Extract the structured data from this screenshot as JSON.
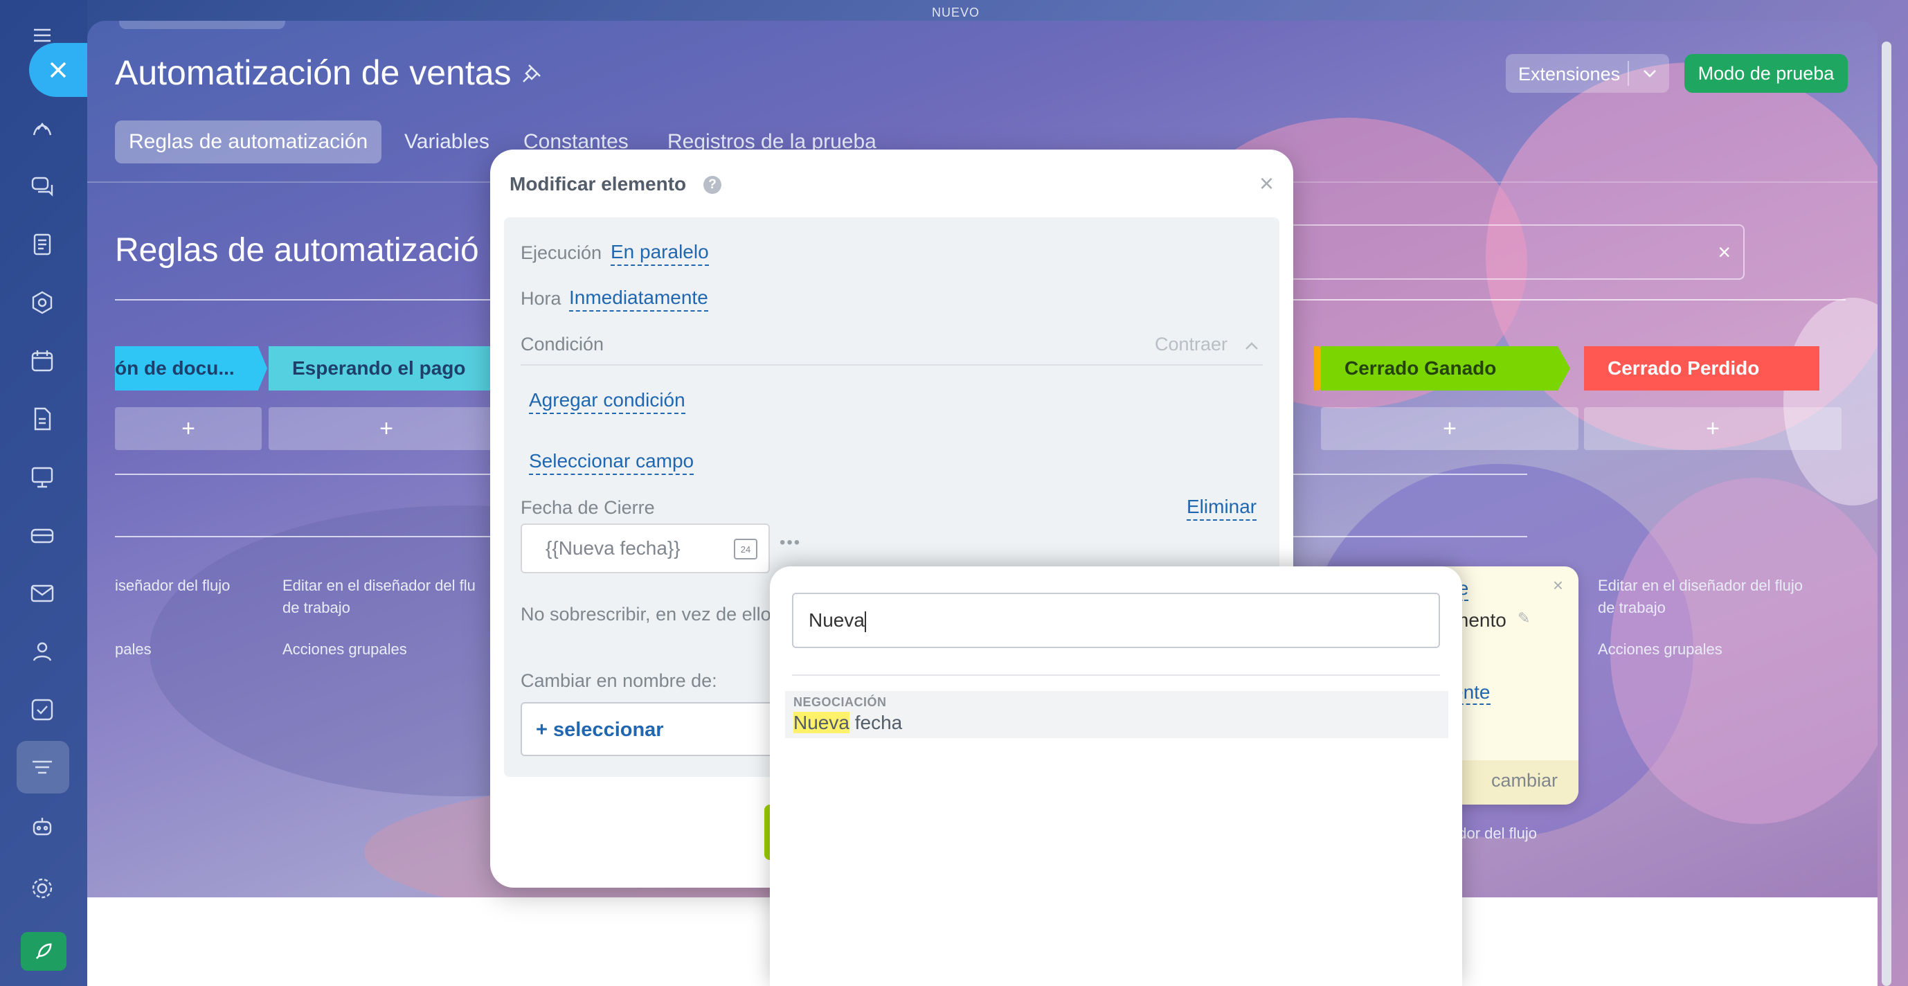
{
  "app": {
    "top_label": "NUEVO"
  },
  "header": {
    "title": "Automatización de ventas",
    "extensions_label": "Extensiones",
    "test_mode_label": "Modo de prueba"
  },
  "tabs": [
    {
      "label": "Reglas de automatización"
    },
    {
      "label": "Variables"
    },
    {
      "label": "Constantes"
    },
    {
      "label": "Registros de la prueba"
    }
  ],
  "section": {
    "title": "Reglas de automatizació"
  },
  "stages": [
    {
      "label": "ón de docu...",
      "color": "#2fc6f6"
    },
    {
      "label": "Esperando el pago",
      "color": "#55d0e0"
    },
    {
      "label": "Cerrado Ganado",
      "color": "#7bd500"
    },
    {
      "label": "Cerrado Perdido",
      "color": "#ff5752"
    }
  ],
  "plus": "+",
  "footer_links": {
    "designer_left": "iseñador del flujo",
    "designer_mid_1": "Editar en el diseñador del flu",
    "designer_mid_2": "de trabajo",
    "bulk_left": "pales",
    "bulk_mid": "Acciones grupales",
    "designer_right_1": "Editar en el diseñador del flujo",
    "designer_right_2": "de trabajo",
    "bulk_right": "Acciones grupales",
    "designer_bottom": "ador del flujo"
  },
  "modal": {
    "title": "Modificar elemento",
    "help": "?",
    "close": "×",
    "execution_label": "Ejecución",
    "execution_value": "En paralelo",
    "time_label": "Hora",
    "time_value": "Inmediatamente",
    "condition_label": "Condición",
    "collapse_label": "Contraer",
    "add_condition": "Agregar condición",
    "select_field": "Seleccionar campo",
    "field_label": "Fecha de Cierre",
    "delete_label": "Eliminar",
    "date_value": "{{Nueva fecha}}",
    "calendar_day": "24",
    "more": "•••",
    "no_overwrite": "No sobrescribir, en vez de ello",
    "change_on_behalf": "Cambiar en nombre de:",
    "select_button": "+ seleccionar"
  },
  "yellow_popup": {
    "text1": "te",
    "text2": "mento",
    "text3": "ente",
    "change": "cambiar",
    "close": "×"
  },
  "dropdown": {
    "query": "Nueva",
    "group": "NEGOCIACIÓN",
    "result_highlight": "Nueva",
    "result_rest": " fecha"
  }
}
